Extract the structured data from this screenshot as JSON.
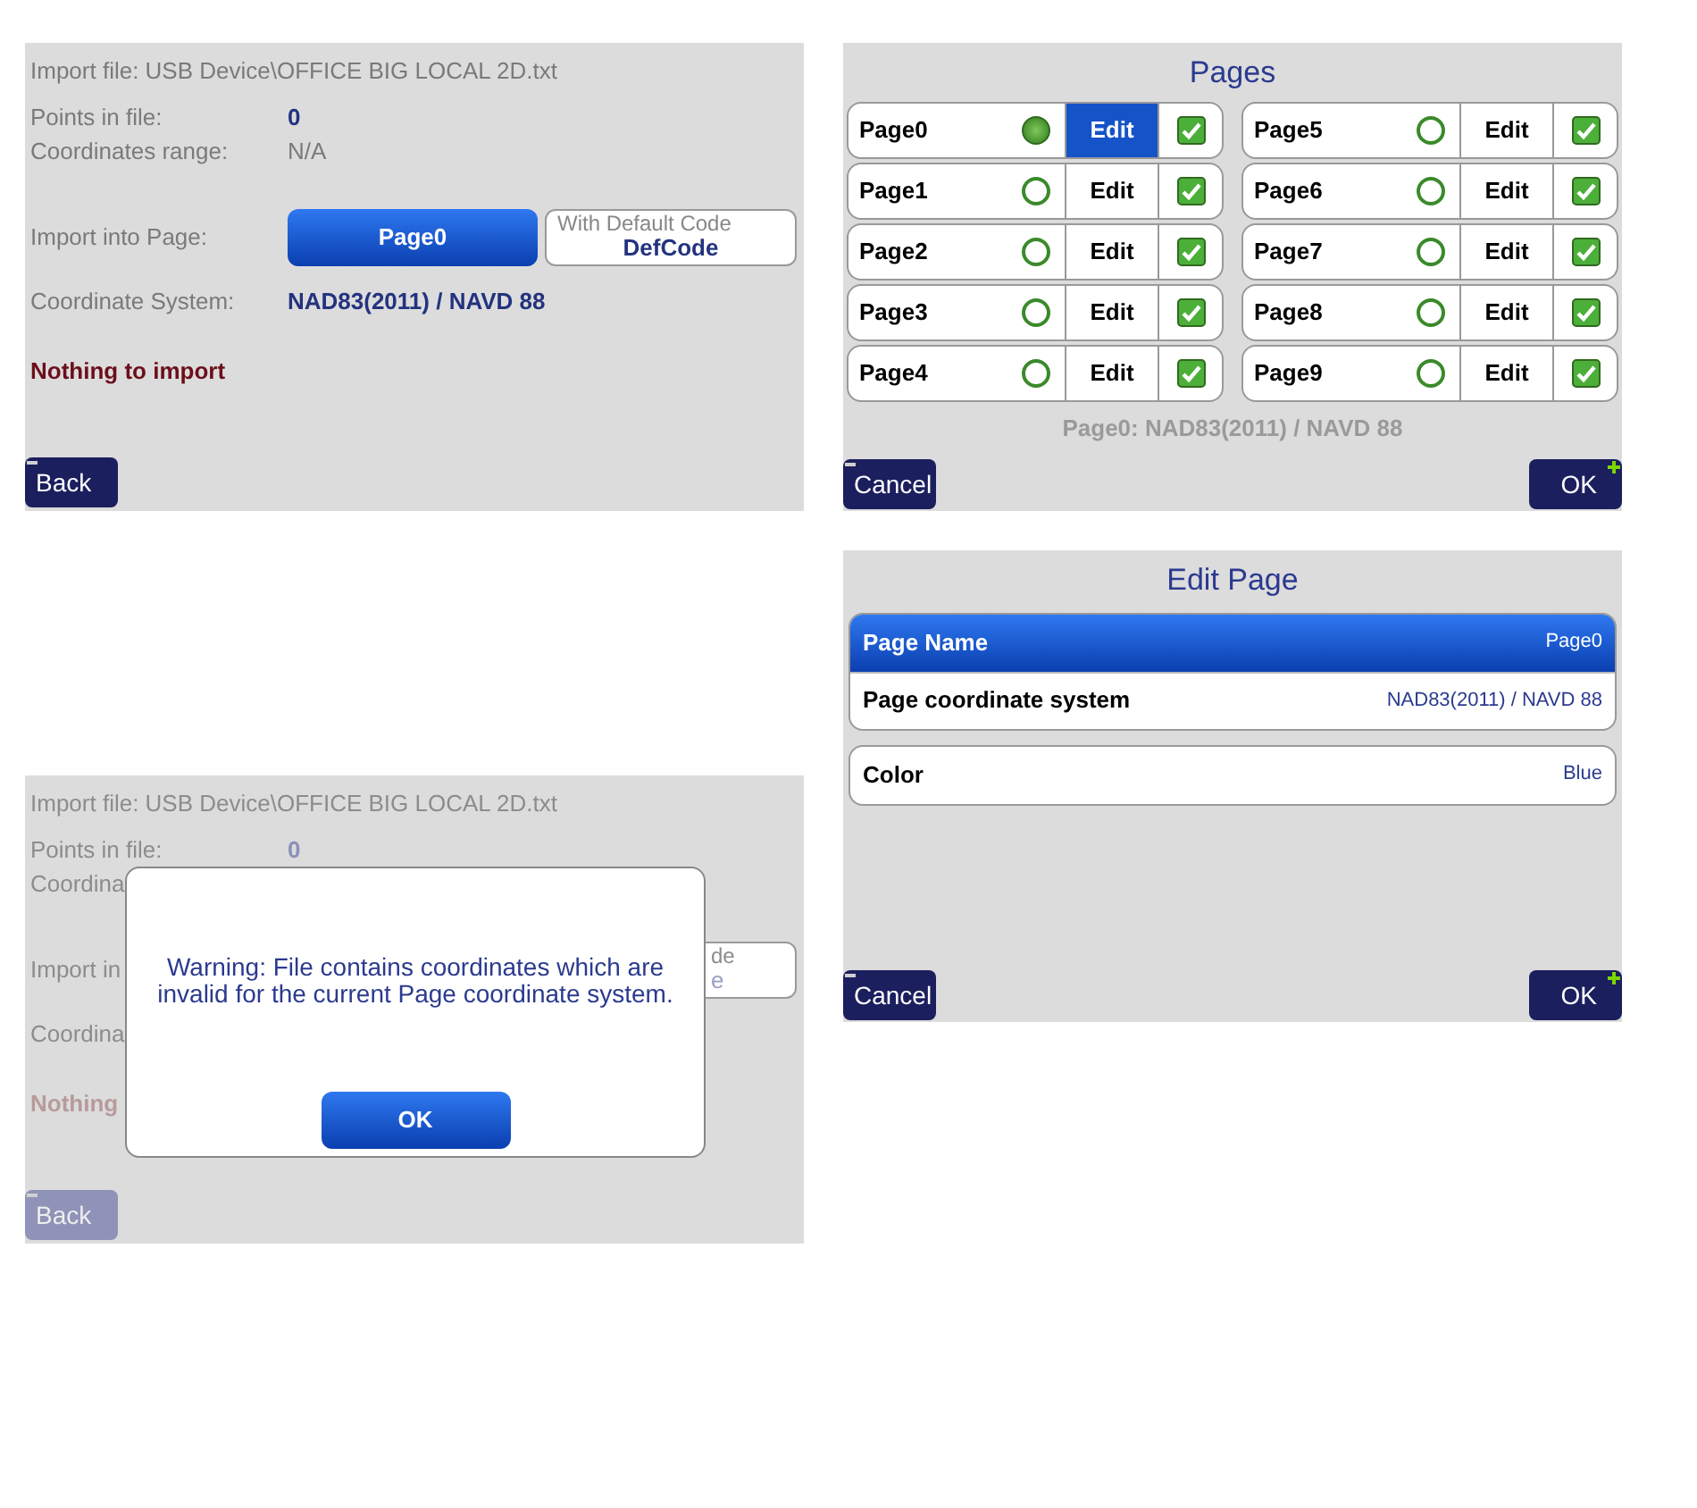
{
  "import_screen": {
    "file": "Import file: USB Device\\OFFICE BIG LOCAL 2D.txt",
    "points_label": "Points in file:",
    "points_value": "0",
    "range_label": "Coordinates range:",
    "range_value": "N/A",
    "page_label": "Import into Page:",
    "page_button": "Page0",
    "code_caption": "With Default Code",
    "code_value": "DefCode",
    "cs_label": "Coordinate System:",
    "cs_value": "NAD83(2011) / NAVD 88",
    "message": "Nothing to import",
    "dimmed": false,
    "back": {
      "label": "Back",
      "kind": "minus"
    }
  },
  "pages_screen": {
    "title": "Pages",
    "pages": [
      {
        "name": "Page0",
        "selected": true,
        "edit_label": "Edit",
        "edit_highlighted": true,
        "checked": true
      },
      {
        "name": "Page1",
        "selected": false,
        "edit_label": "Edit",
        "edit_highlighted": false,
        "checked": true
      },
      {
        "name": "Page2",
        "selected": false,
        "edit_label": "Edit",
        "edit_highlighted": false,
        "checked": true
      },
      {
        "name": "Page3",
        "selected": false,
        "edit_label": "Edit",
        "edit_highlighted": false,
        "checked": true
      },
      {
        "name": "Page4",
        "selected": false,
        "edit_label": "Edit",
        "edit_highlighted": false,
        "checked": true
      },
      {
        "name": "Page5",
        "selected": false,
        "edit_label": "Edit",
        "edit_highlighted": false,
        "checked": true
      },
      {
        "name": "Page6",
        "selected": false,
        "edit_label": "Edit",
        "edit_highlighted": false,
        "checked": true
      },
      {
        "name": "Page7",
        "selected": false,
        "edit_label": "Edit",
        "edit_highlighted": false,
        "checked": true
      },
      {
        "name": "Page8",
        "selected": false,
        "edit_label": "Edit",
        "edit_highlighted": false,
        "checked": true
      },
      {
        "name": "Page9",
        "selected": false,
        "edit_label": "Edit",
        "edit_highlighted": false,
        "checked": true
      }
    ],
    "footer": "Page0: NAD83(2011) / NAVD 88",
    "cancel": {
      "label": "Cancel",
      "kind": "minus"
    },
    "ok": {
      "label": "OK",
      "kind": "plus"
    }
  },
  "edit_page_screen": {
    "title": "Edit Page",
    "groups": [
      {
        "rows": [
          {
            "label": "Page Name",
            "value": "Page0",
            "selected": true
          },
          {
            "label": "Page coordinate system",
            "value": "NAD83(2011) / NAVD 88",
            "selected": false
          }
        ]
      },
      {
        "rows": [
          {
            "label": "Color",
            "value": "Blue",
            "selected": false
          }
        ]
      }
    ],
    "cancel": {
      "label": "Cancel",
      "kind": "minus"
    },
    "ok": {
      "label": "OK",
      "kind": "plus"
    }
  },
  "warning_screen": {
    "background": {
      "file": "Import file: USB Device\\OFFICE BIG LOCAL 2D.txt",
      "points_label": "Points in file:",
      "points_value": "0",
      "range_label": "Coordina",
      "page_label": "Import in",
      "code_caption": "de",
      "code_value": "e",
      "cs_label": "Coordina",
      "message": "Nothing",
      "dimmed": true,
      "back": {
        "label": "Back",
        "kind": "minus"
      }
    },
    "dialog": {
      "message": "Warning: File contains coordinates which are invalid for the current Page coordinate system.",
      "ok": "OK"
    }
  }
}
